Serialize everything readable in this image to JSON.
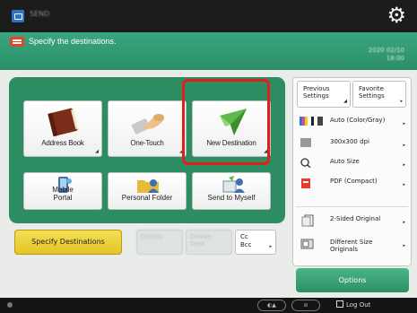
{
  "topbar": {
    "app_name": "SEND",
    "settings_icon": "gear-icon"
  },
  "status": {
    "message": "Specify the destinations.",
    "datetime_line1": "2020 02/10",
    "datetime_line2": "18:00"
  },
  "destinations": {
    "address_book": "Address Book",
    "one_touch": "One-Touch",
    "new_destination": "New Destination",
    "mobile_portal": "Mobile\nPortal",
    "personal_folder": "Personal Folder",
    "send_to_myself": "Send to Myself"
  },
  "actions": {
    "specify_destinations": "Specify Destinations",
    "details": "Details",
    "delete_dest": "Delete\nDest.",
    "cc_bcc": "Cc\nBcc"
  },
  "settings": {
    "previous": "Previous\nSettings",
    "favorite": "Favorite\nSettings",
    "color_mode": "Auto (Color/Gray)",
    "resolution": "300x300 dpi",
    "size": "Auto Size",
    "file_format": "PDF (Compact)",
    "sides": "2-Sided Original",
    "originals": "Different Size\nOriginals",
    "options": "Options"
  },
  "bottombar": {
    "logout": "Log Out"
  },
  "colors": {
    "accent_green": "#2e8c63",
    "highlight": "#e11d1d",
    "yellow_button": "#e8c93a"
  }
}
